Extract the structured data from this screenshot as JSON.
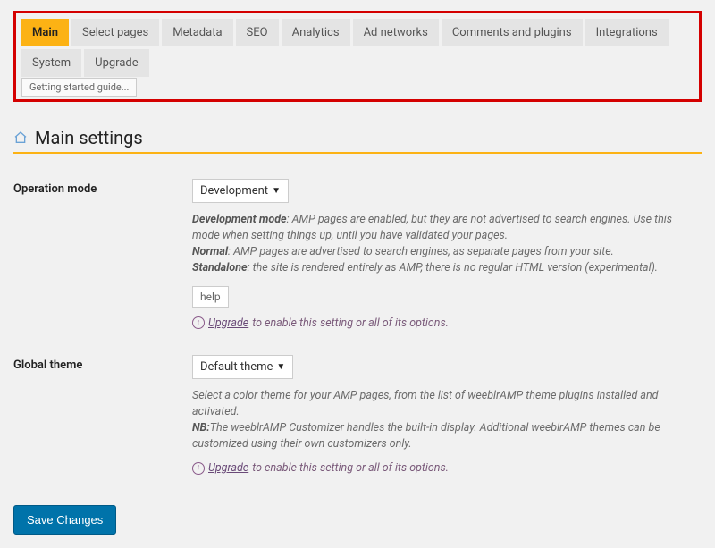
{
  "tabs": [
    {
      "label": "Main",
      "active": true
    },
    {
      "label": "Select pages",
      "active": false
    },
    {
      "label": "Metadata",
      "active": false
    },
    {
      "label": "SEO",
      "active": false
    },
    {
      "label": "Analytics",
      "active": false
    },
    {
      "label": "Ad networks",
      "active": false
    },
    {
      "label": "Comments and plugins",
      "active": false
    },
    {
      "label": "Integrations",
      "active": false
    },
    {
      "label": "System",
      "active": false
    },
    {
      "label": "Upgrade",
      "active": false
    }
  ],
  "subtab": "Getting started guide...",
  "section_title": "Main settings",
  "operation": {
    "label": "Operation mode",
    "select_value": "Development",
    "desc_dev_b": "Development mode",
    "desc_dev": ": AMP pages are enabled, but they are not advertised to search engines. Use this mode when setting things up, until you have validated your pages.",
    "desc_norm_b": "Normal",
    "desc_norm": ": AMP pages are advertised to search engines, as separate pages from your site.",
    "desc_sa_b": "Standalone",
    "desc_sa": ": the site is rendered entirely as AMP, there is no regular HTML version (experimental).",
    "help": "help",
    "upgrade_link": "Upgrade",
    "upgrade_rest": " to enable this setting or all of its options."
  },
  "global_theme": {
    "label": "Global theme",
    "select_value": "Default theme",
    "desc_line1": "Select a color theme for your AMP pages, from the list of weeblrAMP theme plugins installed and activated.",
    "desc_nb_b": "NB:",
    "desc_nb": "The weeblrAMP Customizer handles the built-in display. Additional weeblrAMP themes can be customized using their own customizers only.",
    "upgrade_link": "Upgrade",
    "upgrade_rest": " to enable this setting or all of its options."
  },
  "save_label": "Save Changes"
}
